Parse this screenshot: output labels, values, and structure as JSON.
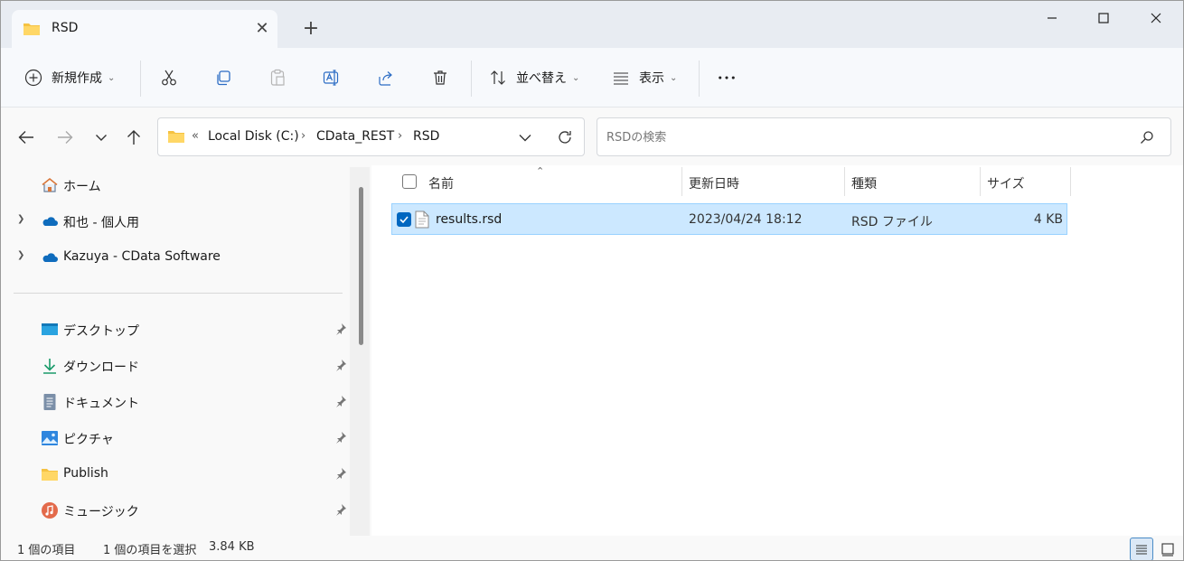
{
  "window": {
    "tab_title": "RSD"
  },
  "commands": {
    "new": "新規作成",
    "sort": "並べ替え",
    "view": "表示"
  },
  "address": {
    "overflow": "«",
    "crumbs": [
      "Local Disk (C:)",
      "CData_REST",
      "RSD"
    ]
  },
  "search": {
    "placeholder": "RSDの検索"
  },
  "sidebar": {
    "items": [
      {
        "label": "ホーム"
      },
      {
        "label": "和也 - 個人用"
      },
      {
        "label": "Kazuya - CData Software"
      },
      {
        "label": "デスクトップ"
      },
      {
        "label": "ダウンロード"
      },
      {
        "label": "ドキュメント"
      },
      {
        "label": "ピクチャ"
      },
      {
        "label": "Publish"
      },
      {
        "label": "ミュージック"
      }
    ]
  },
  "columns": {
    "name": "名前",
    "modified": "更新日時",
    "type": "種類",
    "size": "サイズ"
  },
  "files": [
    {
      "name": "results.rsd",
      "modified": "2023/04/24 18:12",
      "type": "RSD ファイル",
      "size": "4 KB",
      "selected": true
    }
  ],
  "status": {
    "count": "1 個の項目",
    "selection": "1 個の項目を選択",
    "selection_size": "3.84 KB"
  },
  "colors": {
    "accent": "#0067c0",
    "selection_bg": "#cce8ff",
    "folder": "#f5c242"
  }
}
